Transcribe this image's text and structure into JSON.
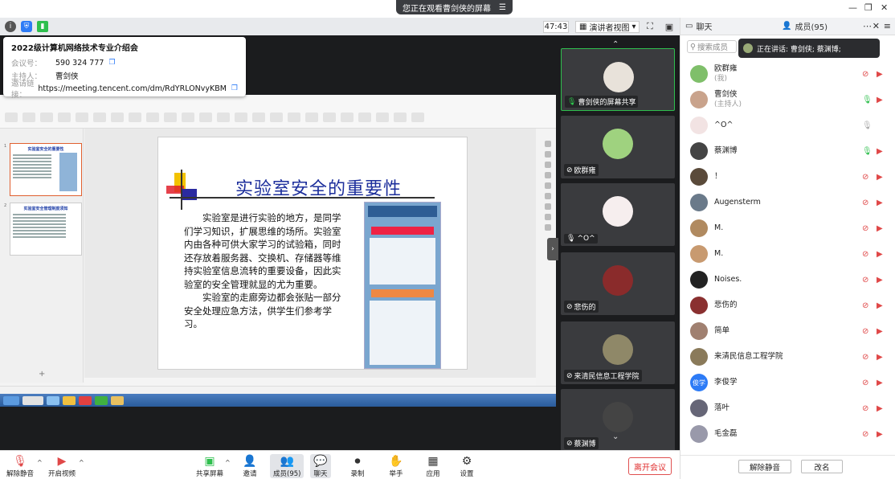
{
  "banner": {
    "text": "您正在观看曹剑侠的屏幕"
  },
  "toolbar": {
    "timer": "47:43",
    "view_mode": "演讲者视图"
  },
  "meeting_info": {
    "title": "2022级计算机网络技术专业介绍会",
    "rows": [
      {
        "key": "会议号：",
        "value": "590 324 777"
      },
      {
        "key": "主持人：",
        "value": "曹剑侠"
      },
      {
        "key": "邀请链接：",
        "value": "https://meeting.tencent.com/dm/RdYRLONvyKBM"
      }
    ]
  },
  "slide": {
    "title": "实验室安全的重要性",
    "paragraphs": [
      "实验室是进行实验的地方，是同学们学习知识，扩展思维的场所。实验室内由各种可供大家学习的试验箱，同时还存放着服务器、交换机、存储器等维持实验室信息流转的重要设备，因此实验室的安全管理就显的尤为重要。",
      "实验室的走廊旁边都会张贴一部分安全处理应急方法，供学生们参考学习。"
    ],
    "thumbs": [
      {
        "num": "1",
        "title": "实验室安全的重要性"
      },
      {
        "num": "2",
        "title": "实验室安全管理制度须知"
      }
    ]
  },
  "video_tiles": [
    {
      "name": "曹剑侠的屏幕共享",
      "mic": "on"
    },
    {
      "name": "欧群雍",
      "mic": "off"
    },
    {
      "name": "^O^",
      "mic": "idle"
    },
    {
      "name": "悲伤的",
      "mic": "off"
    },
    {
      "name": "来清民信息工程学院",
      "mic": "off"
    },
    {
      "name": "蔡渊博",
      "mic": "off"
    }
  ],
  "panel": {
    "chat_tab": "聊天",
    "members_tab": "成员(95)",
    "search_placeholder": "搜索成员",
    "speaking": "正在讲话: 曹剑侠; 蔡渊博;",
    "unmute_all": "解除静音",
    "rename": "改名",
    "members": [
      {
        "name": "欧群雍",
        "sub": "(我)",
        "mic": "muted",
        "color": "#7fbf6a"
      },
      {
        "name": "曹剑侠",
        "sub": "(主持人)",
        "mic": "green",
        "color": "#c9a38c"
      },
      {
        "name": "^O^",
        "sub": "",
        "mic": "gray",
        "color": "#f2e3e3"
      },
      {
        "name": "蔡渊博",
        "sub": "",
        "mic": "green",
        "color": "#444"
      },
      {
        "name": "！",
        "sub": "",
        "mic": "muted",
        "color": "#5a4a3a"
      },
      {
        "name": "Augensterm",
        "sub": "",
        "mic": "muted",
        "color": "#6a7a8a"
      },
      {
        "name": "M.",
        "sub": "",
        "mic": "muted",
        "color": "#b08a60"
      },
      {
        "name": "M.",
        "sub": "",
        "mic": "muted",
        "color": "#c89a70"
      },
      {
        "name": "Noises.",
        "sub": "",
        "mic": "muted",
        "color": "#222"
      },
      {
        "name": "悲伤的",
        "sub": "",
        "mic": "muted",
        "color": "#8a3030"
      },
      {
        "name": "简单",
        "sub": "",
        "mic": "muted",
        "color": "#a08070"
      },
      {
        "name": "来清民信息工程学院",
        "sub": "",
        "mic": "muted",
        "color": "#8a7a5a"
      },
      {
        "name": "李俊学",
        "sub": "",
        "mic": "muted",
        "color": "#2d7bf6",
        "avatar_text": "俊学"
      },
      {
        "name": "落叶",
        "sub": "",
        "mic": "muted",
        "color": "#667"
      },
      {
        "name": "毛金磊",
        "sub": "",
        "mic": "muted",
        "color": "#99a"
      }
    ]
  },
  "controls": {
    "unmute": "解除静音",
    "start_video": "开启视频",
    "share_screen": "共享屏幕",
    "invite": "邀请",
    "members": "成员(95)",
    "chat": "聊天",
    "record": "录制",
    "raise_hand": "举手",
    "apps": "应用",
    "settings": "设置",
    "leave": "离开会议"
  }
}
